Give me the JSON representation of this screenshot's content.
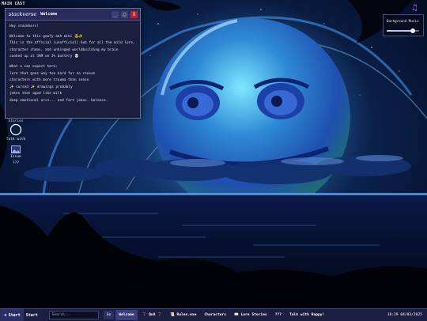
{
  "desktop": {
    "section_label": "MAIN CAST",
    "icons": [
      {
        "label": "Lore Stories",
        "icon": "circle-icon"
      },
      {
        "label": "Talk with",
        "icon": "chat-icon"
      },
      {
        "label": "Issue",
        "icon": "image-icon"
      },
      {
        "label": "???",
        "icon": "question-icon"
      }
    ]
  },
  "window": {
    "logo": "stackverse",
    "title": "Welcome",
    "buttons": {
      "minimize": "_",
      "maximize": "▢",
      "close": "X"
    },
    "lines": [
      "Hey stackkers!",
      "Welcome to this goofy aah miki 😎✨",
      "This is the official (unofficial) hub for all the mild lore,",
      "character chaos, and unhinged worldbuilding my brain",
      "cooked up at 3AM on 2% battery 💀",
      "What u can expect here:",
      "lore that goes way too hard for no reason",
      "characters with more trauma than sense",
      "✨ cursed ✨ drawings probably",
      "jokes that aged like milk",
      "deep emotional arcs... and fart jokes. balance."
    ]
  },
  "music_widget": {
    "label": "Background Music",
    "volume": 0.8,
    "icon": "music-note-icon"
  },
  "taskbar": {
    "start_label": "Start",
    "start_text": "Start",
    "search_placeholder": "Search...",
    "go_label": "Go",
    "tasks": [
      {
        "label": "Welcome",
        "active": true
      },
      {
        "label": "❓ QnA ❓",
        "active": false
      },
      {
        "label": "📜 Rules.exe",
        "active": false
      },
      {
        "label": "Characters",
        "active": false
      },
      {
        "label": "📖 Lore Stories",
        "active": false
      },
      {
        "label": "???",
        "active": false
      },
      {
        "label": "Talk with Happy!",
        "active": false
      }
    ],
    "clock": "18:29 04/03/2025"
  },
  "colors": {
    "taskbar_bg": "#1c1e40",
    "window_bg": "#1b1e3c",
    "close_red": "#c21f2e",
    "accent_purple": "#b065e8"
  }
}
